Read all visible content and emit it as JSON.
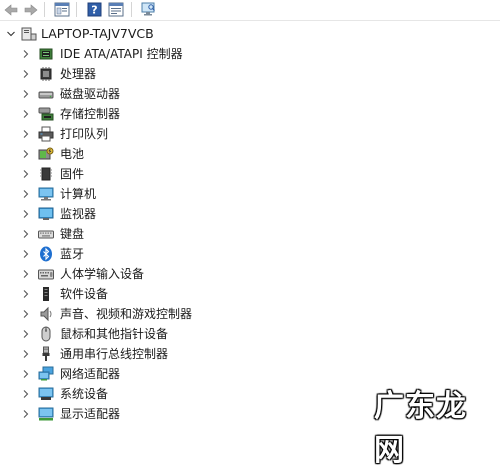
{
  "toolbar": {
    "buttons": [
      {
        "name": "back-icon"
      },
      {
        "name": "forward-icon"
      },
      {
        "name": "show-hide-console-tree-icon"
      },
      {
        "name": "help-icon"
      },
      {
        "name": "properties-icon"
      },
      {
        "name": "scan-hardware-icon"
      }
    ]
  },
  "tree": {
    "root": {
      "label": "LAPTOP-TAJV7VCB",
      "icon": "computer-root-icon"
    },
    "categories": [
      {
        "label": "IDE ATA/ATAPI 控制器",
        "icon": "ide-controller-icon"
      },
      {
        "label": "处理器",
        "icon": "processor-icon"
      },
      {
        "label": "磁盘驱动器",
        "icon": "disk-drive-icon"
      },
      {
        "label": "存储控制器",
        "icon": "storage-controller-icon"
      },
      {
        "label": "打印队列",
        "icon": "printer-icon"
      },
      {
        "label": "电池",
        "icon": "battery-icon"
      },
      {
        "label": "固件",
        "icon": "firmware-icon"
      },
      {
        "label": "计算机",
        "icon": "computer-icon"
      },
      {
        "label": "监视器",
        "icon": "monitor-icon"
      },
      {
        "label": "键盘",
        "icon": "keyboard-icon"
      },
      {
        "label": "蓝牙",
        "icon": "bluetooth-icon"
      },
      {
        "label": "人体学输入设备",
        "icon": "hid-icon"
      },
      {
        "label": "软件设备",
        "icon": "software-device-icon"
      },
      {
        "label": "声音、视频和游戏控制器",
        "icon": "speaker-icon"
      },
      {
        "label": "鼠标和其他指针设备",
        "icon": "mouse-icon"
      },
      {
        "label": "通用串行总线控制器",
        "icon": "usb-icon"
      },
      {
        "label": "网络适配器",
        "icon": "network-adapter-icon"
      },
      {
        "label": "系统设备",
        "icon": "system-device-icon"
      },
      {
        "label": "显示适配器",
        "icon": "display-adapter-icon"
      }
    ]
  },
  "watermark": {
    "text": "广东龙网"
  }
}
